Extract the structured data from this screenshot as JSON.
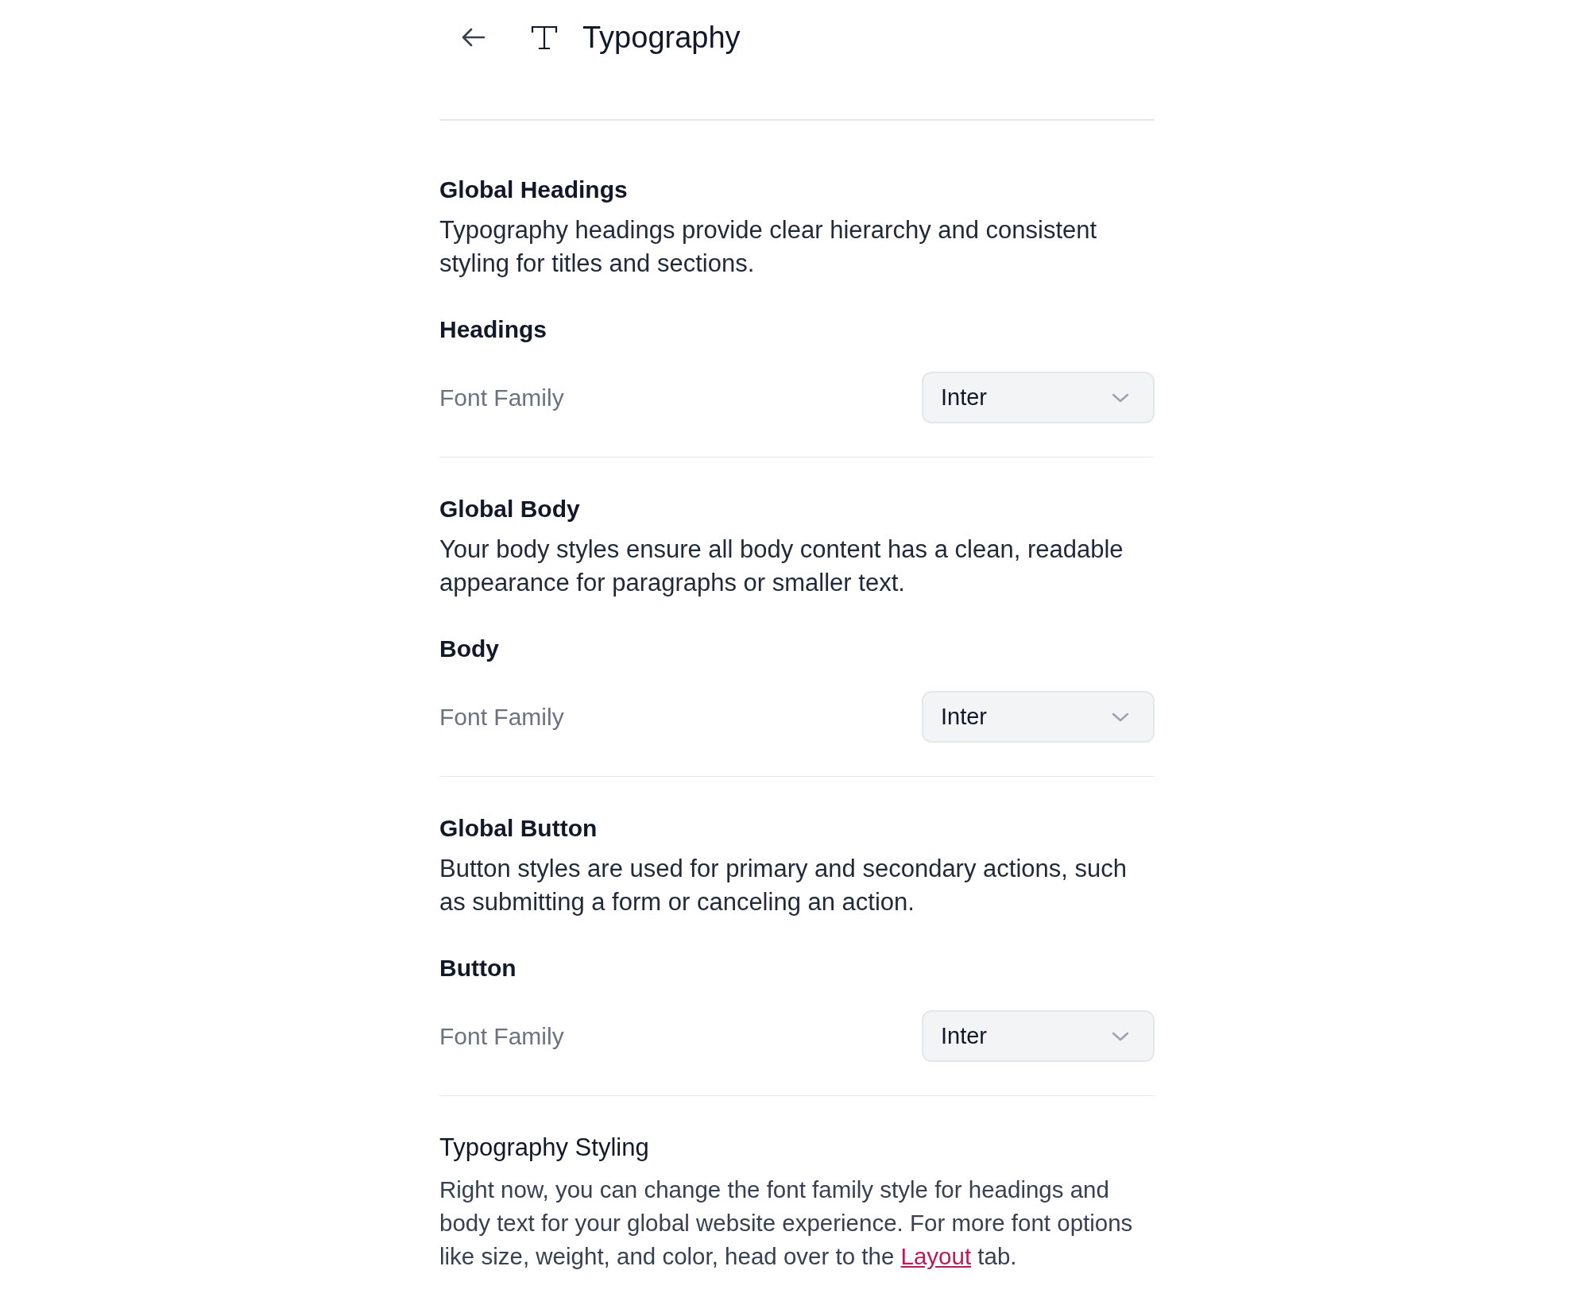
{
  "header": {
    "title": "Typography"
  },
  "sections": [
    {
      "title": "Global Headings",
      "description": "Typography headings provide clear hierarchy and consistent styling for titles and sections.",
      "subheading": "Headings",
      "field": {
        "label": "Font Family",
        "value": "Inter"
      }
    },
    {
      "title": "Global Body",
      "description": "Your body styles ensure all body content has a clean, readable appearance for paragraphs or smaller text.",
      "subheading": "Body",
      "field": {
        "label": "Font Family",
        "value": "Inter"
      }
    },
    {
      "title": "Global Button",
      "description": "Button styles are used for primary and secondary actions, such as submitting a form or canceling an action.",
      "subheading": "Button",
      "field": {
        "label": "Font Family",
        "value": "Inter"
      }
    }
  ],
  "note": {
    "title": "Typography Styling",
    "text_before": "Right now, you can change the font family style for headings and body text for your global website experience. For more font options like size, weight, and color, head over to the ",
    "link": "Layout",
    "text_after": " tab."
  }
}
